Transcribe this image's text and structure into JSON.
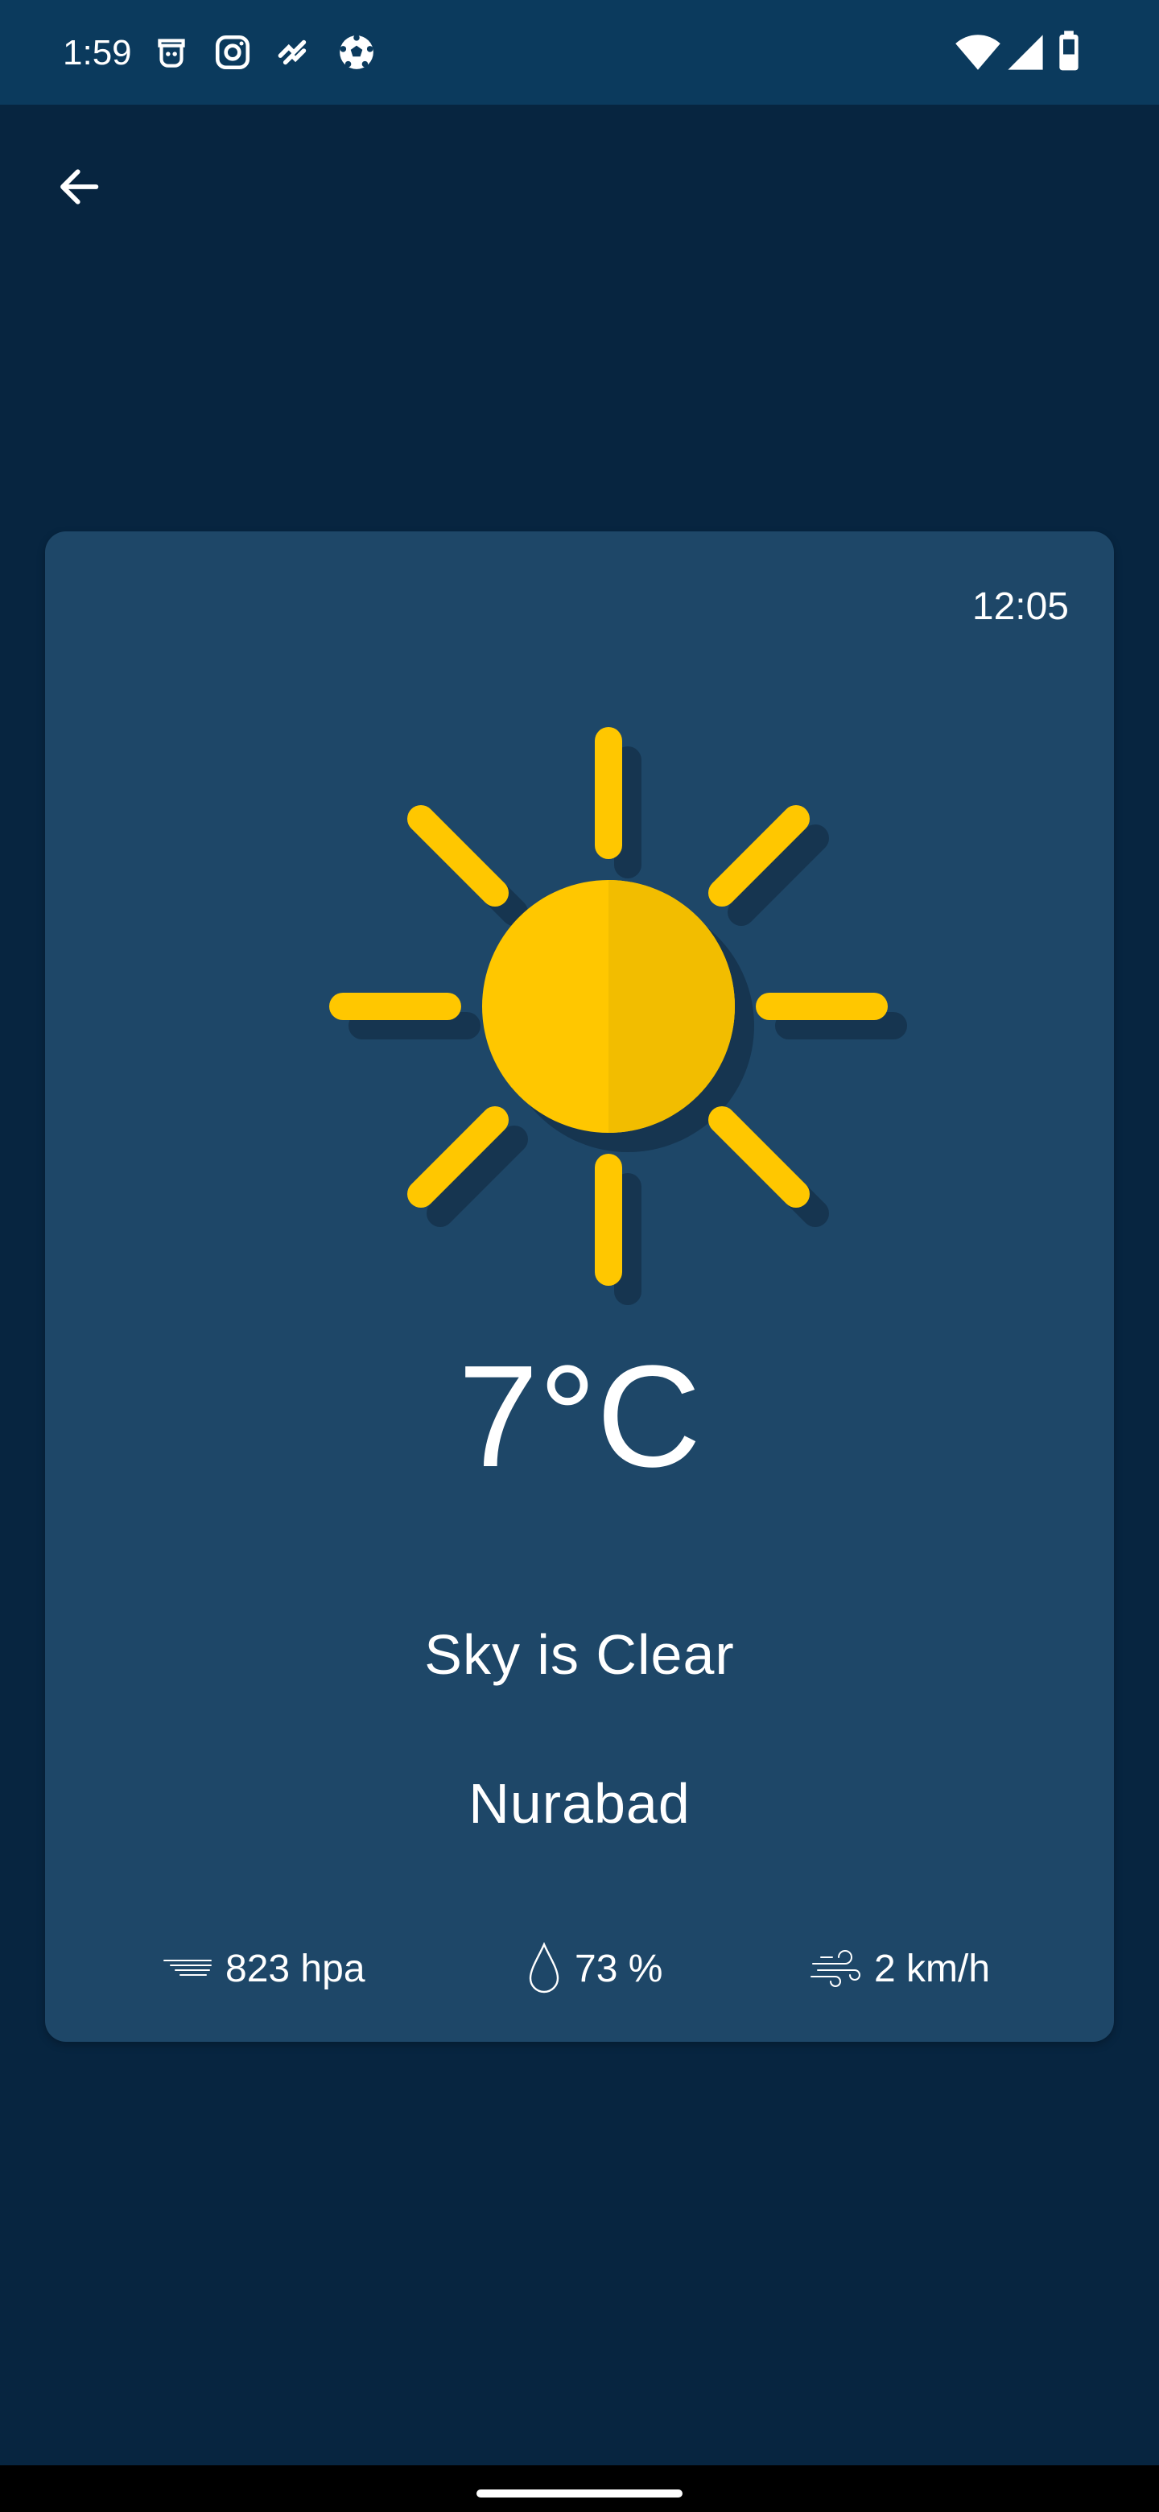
{
  "status_bar": {
    "time": "1:59",
    "notification_icons": [
      "bot-icon",
      "instagram-icon",
      "activity-icon",
      "soccer-ball-icon"
    ],
    "system_icons": [
      "wifi-icon",
      "signal-icon",
      "battery-icon"
    ]
  },
  "nav": {
    "back_icon": "arrow-left-icon"
  },
  "weather": {
    "time": "12:05",
    "condition_icon": "sun-icon",
    "temperature": "7°C",
    "description": "Sky is Clear",
    "city": "Nurabad",
    "pressure": {
      "icon": "pressure-icon",
      "value": "823 hpa"
    },
    "humidity": {
      "icon": "droplet-icon",
      "value": "73 %"
    },
    "wind": {
      "icon": "wind-icon",
      "value": "2 km/h"
    }
  },
  "colors": {
    "background": "#072540",
    "status_bar": "#0b3a5d",
    "card": "#1e4768",
    "sun_primary": "#ffc700",
    "sun_shade": "#f2bd00",
    "sun_shadow": "#163550"
  }
}
